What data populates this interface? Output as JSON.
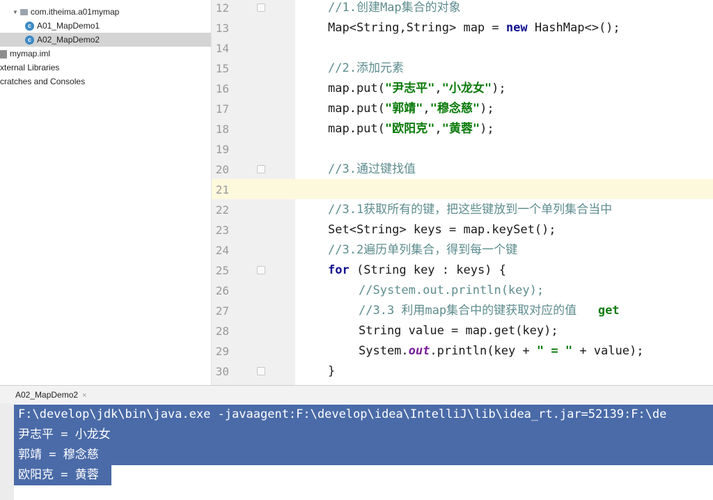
{
  "project_tree": {
    "items": [
      {
        "label": "com.itheima.a01mymap",
        "icon": "folder-icon",
        "selected": false
      },
      {
        "label": "A01_MapDemo1",
        "icon": "class-icon",
        "selected": false
      },
      {
        "label": "A02_MapDemo2",
        "icon": "class-icon",
        "selected": true
      },
      {
        "label": "mymap.iml",
        "icon": "iml-file-icon",
        "selected": false
      },
      {
        "label": "xternal Libraries",
        "icon": "",
        "selected": false
      },
      {
        "label": "cratches and Consoles",
        "icon": "",
        "selected": false
      }
    ]
  },
  "editor": {
    "current_line": "21",
    "lines": [
      {
        "no": "12",
        "text": "//1.创建Map集合的对象"
      },
      {
        "no": "13",
        "text": "Map<String,String> map = new HashMap<>();"
      },
      {
        "no": "14",
        "text": ""
      },
      {
        "no": "15",
        "text": "//2.添加元素"
      },
      {
        "no": "16",
        "text": "map.put(\"尹志平\",\"小龙女\");"
      },
      {
        "no": "17",
        "text": "map.put(\"郭靖\",\"穆念慈\");"
      },
      {
        "no": "18",
        "text": "map.put(\"欧阳克\",\"黄蓉\");"
      },
      {
        "no": "19",
        "text": ""
      },
      {
        "no": "20",
        "text": "//3.通过键找值"
      },
      {
        "no": "21",
        "text": ""
      },
      {
        "no": "22",
        "text": "//3.1获取所有的键，把这些键放到一个单列集合当中"
      },
      {
        "no": "23",
        "text": "Set<String> keys = map.keySet();"
      },
      {
        "no": "24",
        "text": "//3.2遍历单列集合，得到每一个键"
      },
      {
        "no": "25",
        "text": "for (String key : keys) {"
      },
      {
        "no": "26",
        "text": "//System.out.println(key);"
      },
      {
        "no": "27",
        "text": "//3.3 利用map集合中的键获取对应的值   get"
      },
      {
        "no": "28",
        "text": "String value = map.get(key);"
      },
      {
        "no": "29",
        "text": "System.out.println(key + \" = \" + value);"
      },
      {
        "no": "30",
        "text": "}"
      }
    ]
  },
  "run_panel": {
    "tab_label": "A02_MapDemo2",
    "tab_close": "×",
    "console": [
      "F:\\develop\\jdk\\bin\\java.exe -javaagent:F:\\develop\\idea\\IntelliJ\\lib\\idea_rt.jar=52139:F:\\de",
      "尹志平 = 小龙女",
      "郭靖 = 穆念慈",
      "欧阳克 = 黄蓉"
    ]
  },
  "colors": {
    "selection": "#4a6ba8",
    "current_line": "#fdf9dd",
    "comment": "#5e8c8e",
    "keyword": "#11118f",
    "string": "#0a7a0a",
    "field": "#7a1f9a"
  }
}
